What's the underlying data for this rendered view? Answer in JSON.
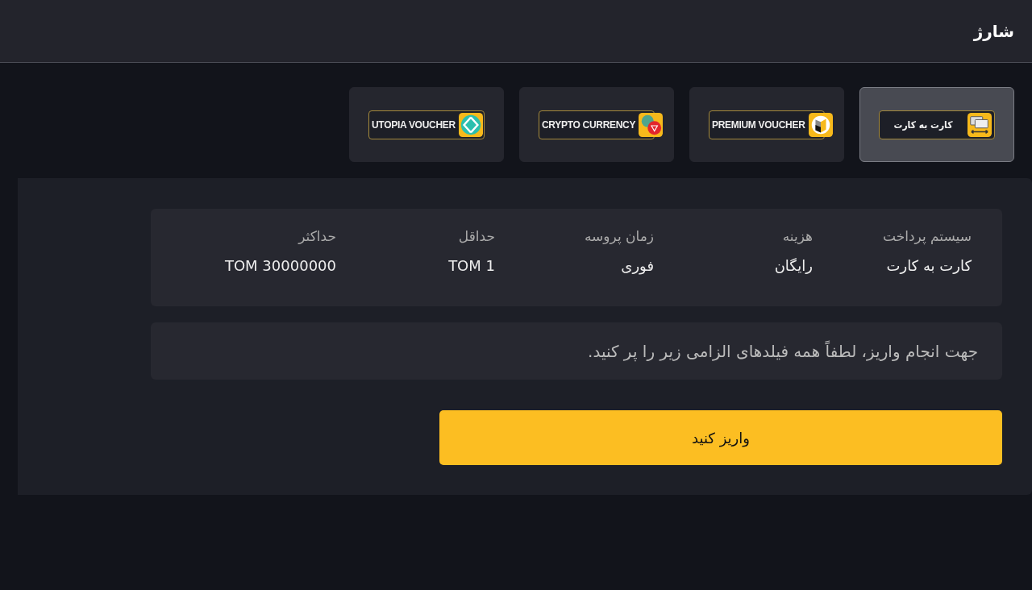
{
  "header": {
    "title": "شارژ"
  },
  "methods": [
    {
      "label": "کارت به کارت",
      "kind": "card",
      "selected": true
    },
    {
      "label": "PREMIUM VOUCHER",
      "kind": "premium",
      "selected": false
    },
    {
      "label": "CRYPTO CURRENCY",
      "kind": "crypto",
      "selected": false
    },
    {
      "label": "UTOPIA VOUCHER",
      "kind": "utopia",
      "selected": false
    }
  ],
  "info": [
    {
      "label": "سیستم پرداخت",
      "value": "کارت به کارت"
    },
    {
      "label": "هزینه",
      "value": "رایگان"
    },
    {
      "label": "زمان پروسه",
      "value": "فوری"
    },
    {
      "label": "حداقل",
      "value": "TOM 1"
    },
    {
      "label": "حداکثر",
      "value": "TOM 30000000"
    }
  ],
  "notice": "جهت انجام واریز، لطفاً همه فیلدهای الزامی زیر را پر کنید.",
  "submit": "واریز کنید"
}
